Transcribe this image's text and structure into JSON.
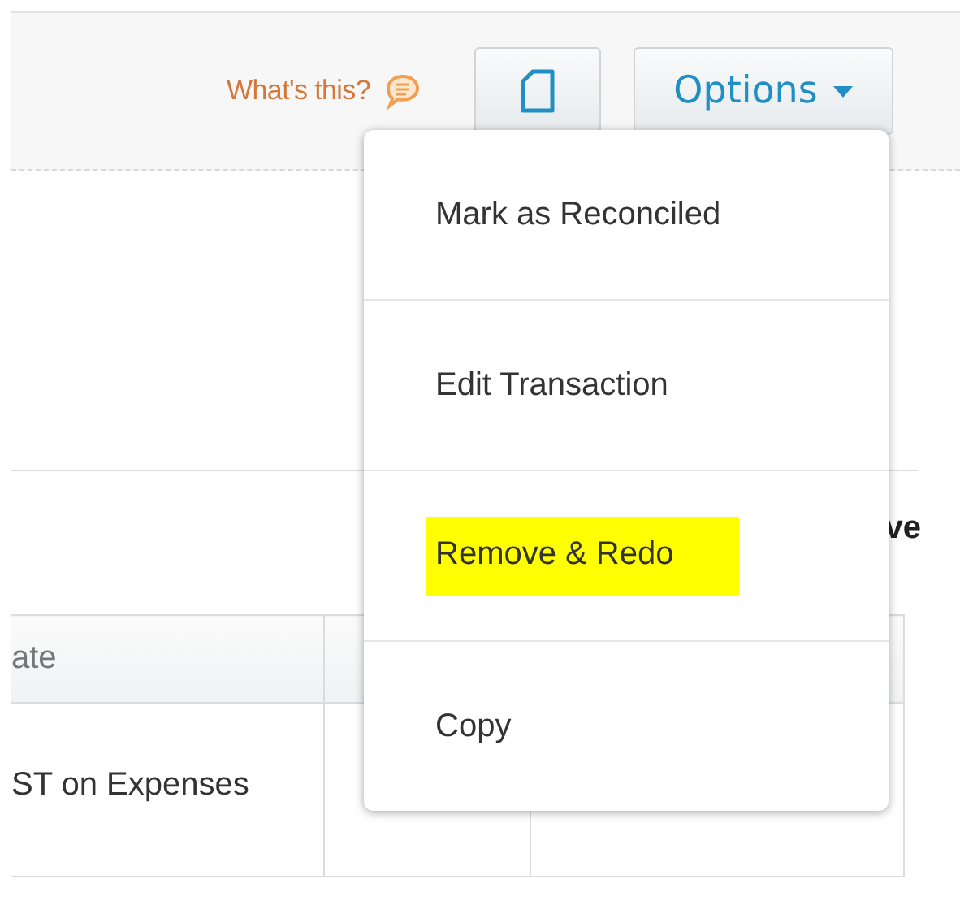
{
  "toolbar": {
    "help_link": "What's this?",
    "options_button": "Options"
  },
  "options_menu": {
    "items": [
      {
        "label": "Mark as Reconciled",
        "highlighted": false
      },
      {
        "label": "Edit Transaction",
        "highlighted": false
      },
      {
        "label": "Remove & Redo",
        "highlighted": true
      },
      {
        "label": "Copy",
        "highlighted": false
      }
    ]
  },
  "section": {
    "text": "ve"
  },
  "table": {
    "columns": [
      "ate"
    ],
    "rows": [
      [
        "ST on Expenses"
      ]
    ]
  }
}
